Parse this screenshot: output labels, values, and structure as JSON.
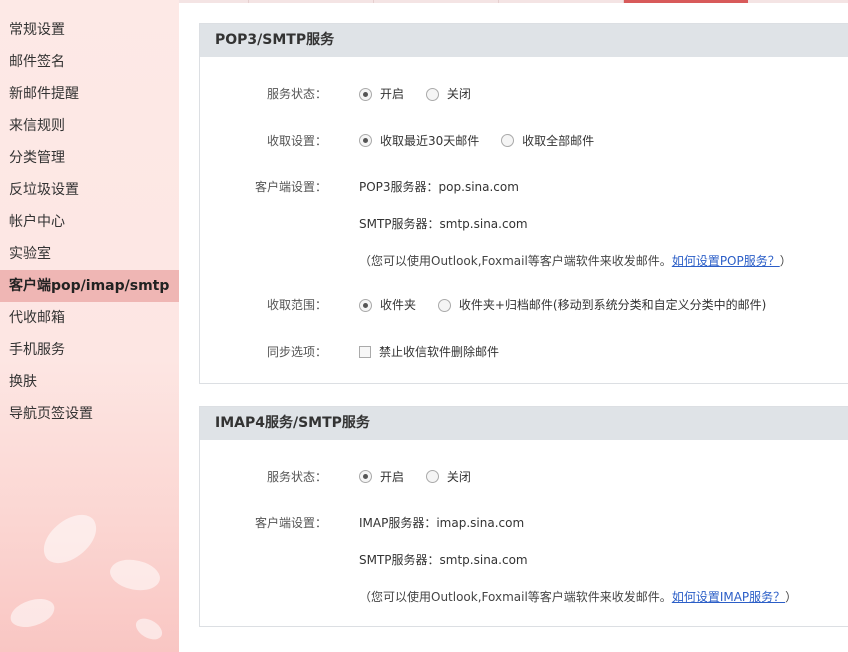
{
  "sidebar": {
    "items": [
      {
        "label": "常规设置"
      },
      {
        "label": "邮件签名"
      },
      {
        "label": "新邮件提醒"
      },
      {
        "label": "来信规则"
      },
      {
        "label": "分类管理"
      },
      {
        "label": "反垃圾设置"
      },
      {
        "label": "帐户中心"
      },
      {
        "label": "实验室"
      },
      {
        "label": "客户端pop/imap/smtp"
      },
      {
        "label": "代收邮箱"
      },
      {
        "label": "手机服务"
      },
      {
        "label": "换肤"
      },
      {
        "label": "导航页签设置"
      }
    ],
    "active_index": 8
  },
  "pop3": {
    "title": "POP3/SMTP服务",
    "status_label": "服务状态：",
    "status_on": "开启",
    "status_off": "关闭",
    "receive_label": "收取设置：",
    "receive_recent": "收取最近30天邮件",
    "receive_all": "收取全部邮件",
    "client_label": "客户端设置：",
    "pop_server": "POP3服务器：pop.sina.com",
    "smtp_server": "SMTP服务器：smtp.sina.com",
    "note_text": "（您可以使用Outlook,Foxmail等客户端软件来收发邮件。",
    "note_link": "如何设置POP服务？",
    "note_end": "）",
    "range_label": "收取范围：",
    "range_inbox": "收件夹",
    "range_inbox_archive": "收件夹+归档邮件(移动到系统分类和自定义分类中的邮件)",
    "sync_label": "同步选项：",
    "sync_option": "禁止收信软件删除邮件"
  },
  "imap": {
    "title": "IMAP4服务/SMTP服务",
    "status_label": "服务状态：",
    "status_on": "开启",
    "status_off": "关闭",
    "client_label": "客户端设置：",
    "imap_server": "IMAP服务器：imap.sina.com",
    "smtp_server": "SMTP服务器：smtp.sina.com",
    "note_text": "（您可以使用Outlook,Foxmail等客户端软件来收发邮件。",
    "note_link": "如何设置IMAP服务？",
    "note_end": "）"
  }
}
